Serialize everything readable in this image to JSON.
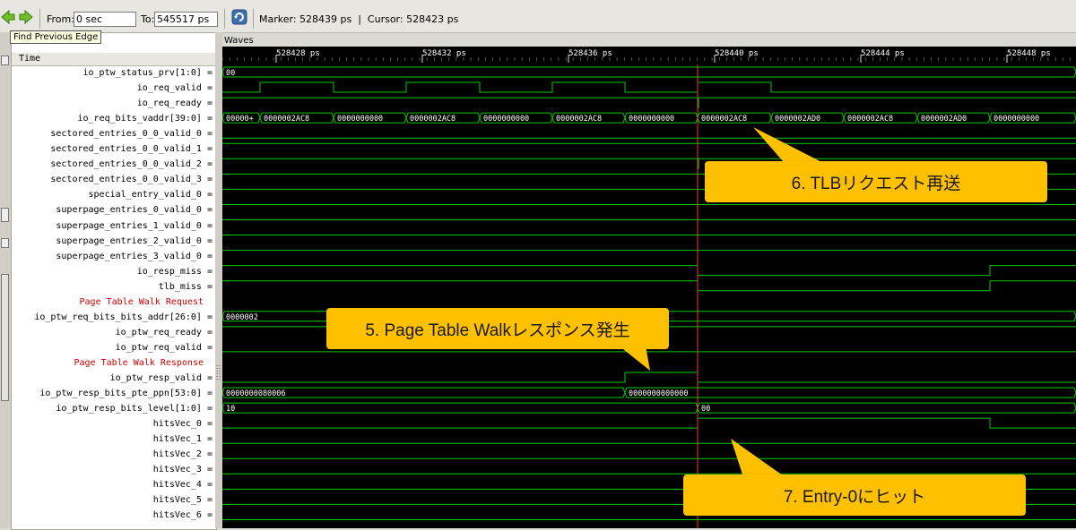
{
  "toolbar": {
    "from_label": "From:",
    "from_value": "0 sec",
    "to_label": "To:",
    "to_value": "545517 ps",
    "marker_cursor": "Marker: 528439 ps  |  Cursor: 528423 ps"
  },
  "tooltip": "Find Previous Edge",
  "waves_title": "Waves",
  "time_header": "Time",
  "time_ticks": [
    "528428 ps",
    "528432 ps",
    "528436 ps",
    "528440 ps",
    "528444 ps",
    "528448 ps"
  ],
  "signals": [
    {
      "name": "io_ptw_status_prv[1:0] =",
      "type": "bus"
    },
    {
      "name": "io_req_valid =",
      "type": "bit"
    },
    {
      "name": "io_req_ready =",
      "type": "bit"
    },
    {
      "name": "io_req_bits_vaddr[39:0] =",
      "type": "bus"
    },
    {
      "name": "sectored_entries_0_0_valid_0 =",
      "type": "bit"
    },
    {
      "name": "sectored_entries_0_0_valid_1 =",
      "type": "bit"
    },
    {
      "name": "sectored_entries_0_0_valid_2 =",
      "type": "bit"
    },
    {
      "name": "sectored_entries_0_0_valid_3 =",
      "type": "bit"
    },
    {
      "name": "special_entry_valid_0 =",
      "type": "bit"
    },
    {
      "name": "superpage_entries_0_valid_0 =",
      "type": "bit"
    },
    {
      "name": "superpage_entries_1_valid_0 =",
      "type": "bit"
    },
    {
      "name": "superpage_entries_2_valid_0 =",
      "type": "bit"
    },
    {
      "name": "superpage_entries_3_valid_0 =",
      "type": "bit"
    },
    {
      "name": "io_resp_miss =",
      "type": "bit"
    },
    {
      "name": "tlb_miss =",
      "type": "bit"
    },
    {
      "name": "Page Table Walk Request",
      "type": "comment"
    },
    {
      "name": "io_ptw_req_bits_bits_addr[26:0] =",
      "type": "bus"
    },
    {
      "name": "io_ptw_req_ready =",
      "type": "bit"
    },
    {
      "name": "io_ptw_req_valid =",
      "type": "bit"
    },
    {
      "name": "Page Table Walk Response",
      "type": "comment"
    },
    {
      "name": "io_ptw_resp_valid =",
      "type": "bit"
    },
    {
      "name": "io_ptw_resp_bits_pte_ppn[53:0] =",
      "type": "bus"
    },
    {
      "name": "io_ptw_resp_bits_level[1:0] =",
      "type": "bus"
    },
    {
      "name": "hitsVec_0 =",
      "type": "bit"
    },
    {
      "name": "hitsVec_1 =",
      "type": "bit"
    },
    {
      "name": "hitsVec_2 =",
      "type": "bit"
    },
    {
      "name": "hitsVec_3 =",
      "type": "bit"
    },
    {
      "name": "hitsVec_4 =",
      "type": "bit"
    },
    {
      "name": "hitsVec_5 =",
      "type": "bit"
    },
    {
      "name": "hitsVec_6 =",
      "type": "bit"
    }
  ],
  "bus_labels": {
    "status_prv": [
      "00"
    ],
    "vaddr": [
      "00000+",
      "0000002AC8",
      "0000000000",
      "0000002AC8",
      "0000000000",
      "0000002AC8",
      "0000000000",
      "0000002AC8",
      "0000002AD0",
      "0000002AC8",
      "0000002AD0",
      "0000000000"
    ],
    "ptw_req_addr": [
      "0000002"
    ],
    "pte_ppn": [
      "0000000080006",
      "0000000000000"
    ],
    "resp_level": [
      "10",
      "00"
    ]
  },
  "callouts": {
    "c6": "6. TLBリクエスト再送",
    "c5": "5. Page Table Walkレスポンス発生",
    "c7": "7. Entry-0にヒット"
  },
  "colors": {
    "wave": "#00cc00",
    "marker": "#ff3030",
    "callout": "#ffc000",
    "comment": "#d00000"
  }
}
